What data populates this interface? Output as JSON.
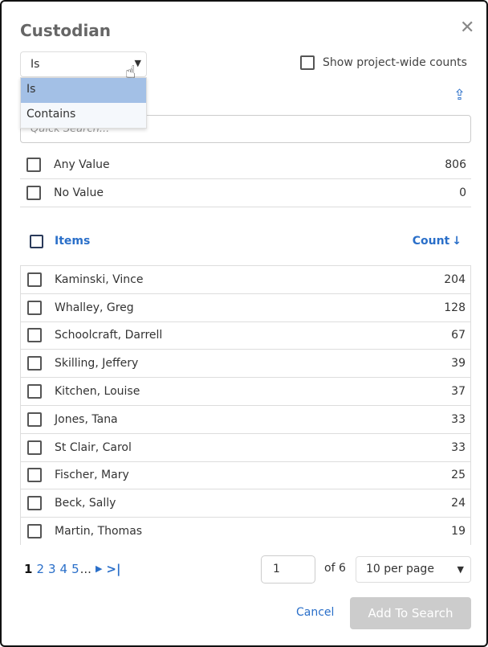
{
  "title": "Custodian",
  "operator": {
    "value": "Is",
    "options": [
      "Is",
      "Contains"
    ]
  },
  "show_project_wide_label": "Show project-wide counts",
  "search_placeholder": "Quick Search...",
  "special": [
    {
      "label": "Any Value",
      "count": "806"
    },
    {
      "label": "No Value",
      "count": "0"
    }
  ],
  "header": {
    "items": "Items",
    "count": "Count"
  },
  "items": [
    {
      "label": "Kaminski, Vince",
      "count": "204"
    },
    {
      "label": "Whalley, Greg",
      "count": "128"
    },
    {
      "label": "Schoolcraft, Darrell",
      "count": "67"
    },
    {
      "label": "Skilling, Jeffery",
      "count": "39"
    },
    {
      "label": "Kitchen, Louise",
      "count": "37"
    },
    {
      "label": "Jones, Tana",
      "count": "33"
    },
    {
      "label": "St Clair, Carol",
      "count": "33"
    },
    {
      "label": "Fischer, Mary",
      "count": "25"
    },
    {
      "label": "Beck, Sally",
      "count": "24"
    },
    {
      "label": "Martin, Thomas",
      "count": "19"
    }
  ],
  "pagination": {
    "pages": [
      "1",
      "2",
      "3",
      "4",
      "5"
    ],
    "ellipsis": "...",
    "current_page": "1",
    "of_label": "of 6",
    "per_page": "10 per page"
  },
  "footer": {
    "cancel": "Cancel",
    "add": "Add To Search"
  },
  "colors": {
    "accent": "#2a6fc9",
    "selected_option": "#a3c0e6",
    "disabled_button": "#cccccc"
  }
}
